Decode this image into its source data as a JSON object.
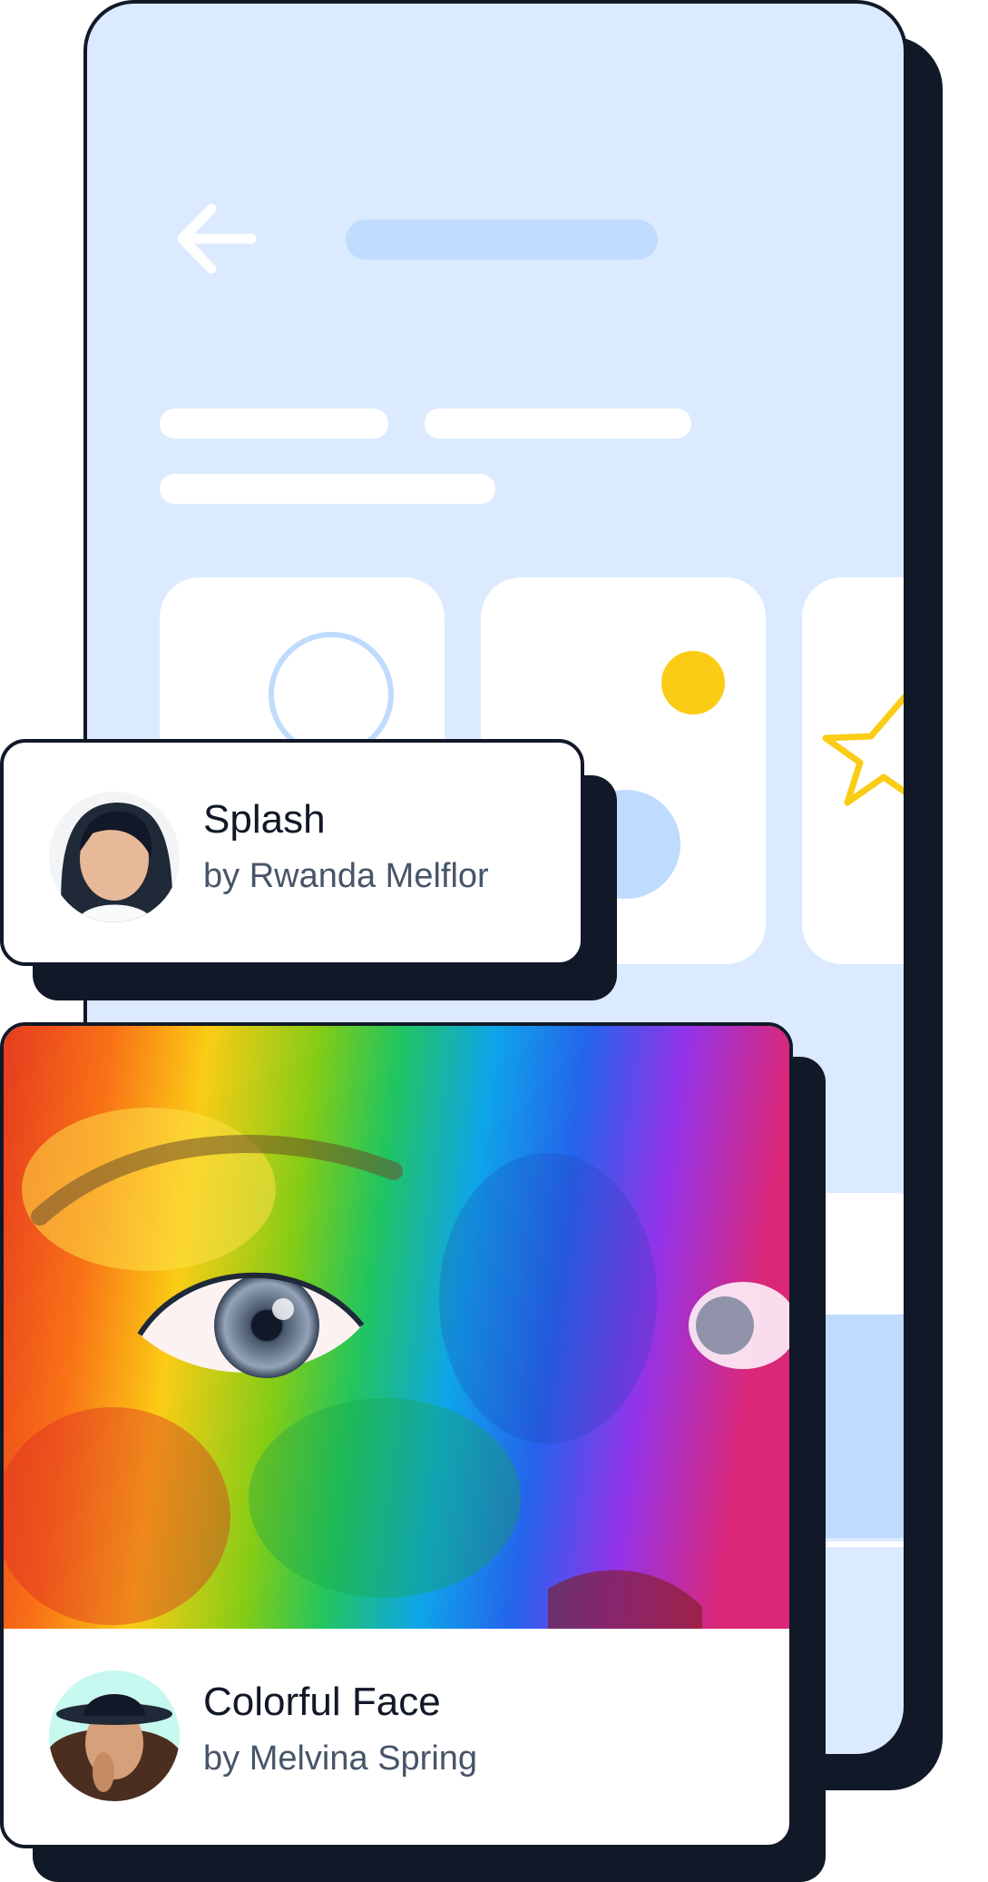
{
  "cards": [
    {
      "title": "Splash",
      "author": "by Rwanda Melflor"
    },
    {
      "title": "Colorful Face",
      "author": "by Melvina Spring"
    }
  ],
  "colors": {
    "phone_bg": "#dbeafe",
    "placeholder_blue": "#bfdbfe",
    "accent_yellow": "#facc15",
    "outline": "#111827",
    "muted_text": "#475569"
  },
  "icons": [
    "arrow-left-icon",
    "circle-icon",
    "dot-icon",
    "star-icon"
  ]
}
